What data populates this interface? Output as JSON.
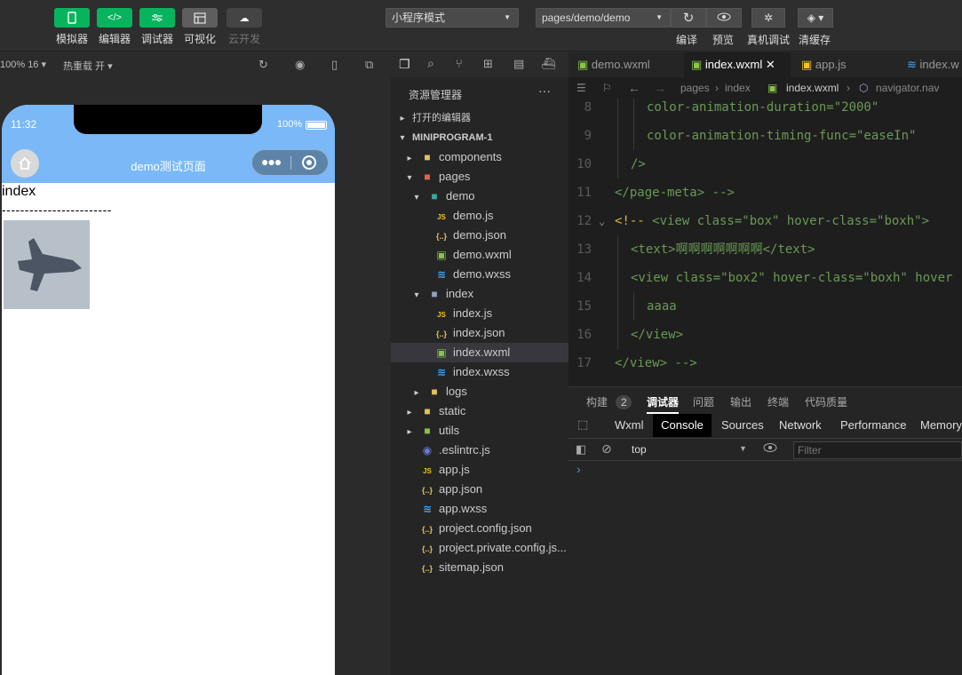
{
  "toolbar": {
    "left_buttons": [
      {
        "label": "模拟器",
        "icon": "phone-icon"
      },
      {
        "label": "编辑器",
        "icon": "code-icon"
      },
      {
        "label": "调试器",
        "icon": "debug-icon"
      },
      {
        "label": "可视化",
        "icon": "layout-icon"
      },
      {
        "label": "云开发",
        "icon": "cloud-icon"
      }
    ],
    "mode_select": "小程序模式",
    "page_select": "pages/demo/demo",
    "right_buttons": [
      {
        "label": "编译",
        "icon": "refresh-icon"
      },
      {
        "label": "预览",
        "icon": "eye-icon"
      },
      {
        "label": "真机调试",
        "icon": "bug-icon"
      },
      {
        "label": "清缓存",
        "icon": "layers-icon"
      }
    ]
  },
  "sim_bar": {
    "zoom": "100% 16",
    "hot_reload": "热重载 开"
  },
  "phone": {
    "time": "11:32",
    "battery": "100%",
    "nav_title": "demo测试页面",
    "content_text": "index",
    "dashes": "------------------------"
  },
  "explorer": {
    "title": "资源管理器",
    "more": "···",
    "open_editors": "打开的编辑器",
    "root": "MINIPROGRAM-1",
    "items": [
      {
        "label": "components",
        "depth": 1,
        "kind": "folder",
        "arrow": "▸"
      },
      {
        "label": "pages",
        "depth": 1,
        "kind": "folder-red",
        "arrow": "▾"
      },
      {
        "label": "demo",
        "depth": 2,
        "kind": "folder-teal",
        "arrow": "▾"
      },
      {
        "label": "demo.js",
        "depth": 3,
        "kind": "js"
      },
      {
        "label": "demo.json",
        "depth": 3,
        "kind": "json"
      },
      {
        "label": "demo.wxml",
        "depth": 3,
        "kind": "wxml"
      },
      {
        "label": "demo.wxss",
        "depth": 3,
        "kind": "wxss"
      },
      {
        "label": "index",
        "depth": 2,
        "kind": "folder-gray",
        "arrow": "▾"
      },
      {
        "label": "index.js",
        "depth": 3,
        "kind": "js"
      },
      {
        "label": "index.json",
        "depth": 3,
        "kind": "json"
      },
      {
        "label": "index.wxml",
        "depth": 3,
        "kind": "wxml",
        "selected": true
      },
      {
        "label": "index.wxss",
        "depth": 3,
        "kind": "wxss"
      },
      {
        "label": "logs",
        "depth": 2,
        "kind": "folder",
        "arrow": "▸"
      },
      {
        "label": "static",
        "depth": 1,
        "kind": "folder",
        "arrow": "▸"
      },
      {
        "label": "utils",
        "depth": 1,
        "kind": "folder-green",
        "arrow": "▸"
      },
      {
        "label": ".eslintrc.js",
        "depth": 1,
        "kind": "eslint"
      },
      {
        "label": "app.js",
        "depth": 1,
        "kind": "js"
      },
      {
        "label": "app.json",
        "depth": 1,
        "kind": "json"
      },
      {
        "label": "app.wxss",
        "depth": 1,
        "kind": "wxss"
      },
      {
        "label": "project.config.json",
        "depth": 1,
        "kind": "json"
      },
      {
        "label": "project.private.config.js...",
        "depth": 1,
        "kind": "json"
      },
      {
        "label": "sitemap.json",
        "depth": 1,
        "kind": "json"
      }
    ]
  },
  "editor": {
    "tabs": [
      {
        "label": "demo.wxml",
        "kind": "wxml"
      },
      {
        "label": "index.wxml",
        "kind": "wxml",
        "active": true,
        "close": "✕"
      },
      {
        "label": "app.js",
        "kind": "js"
      },
      {
        "label": "index.w",
        "kind": "wxss"
      }
    ],
    "breadcrumb": [
      "pages",
      "index",
      "index.wxml",
      "navigator.nav"
    ],
    "lines": [
      {
        "n": "8",
        "indent": 2,
        "text": "color-animation-duration=\"2000\""
      },
      {
        "n": "9",
        "indent": 2,
        "text": "color-animation-timing-func=\"easeIn\""
      },
      {
        "n": "10",
        "indent": 1,
        "text": "/>"
      },
      {
        "n": "11",
        "indent": 0,
        "text": "</page-meta> -->"
      },
      {
        "n": "12",
        "indent": 0,
        "text": "<!-- <view class=\"box\" hover-class=\"boxh\">",
        "fold": "⌄"
      },
      {
        "n": "13",
        "indent": 1,
        "text": "<text>啊啊啊啊啊啊啊</text>"
      },
      {
        "n": "14",
        "indent": 1,
        "text": "<view class=\"box2\" hover-class=\"boxh\" hover"
      },
      {
        "n": "15",
        "indent": 2,
        "text": "aaaa"
      },
      {
        "n": "16",
        "indent": 1,
        "text": "</view>"
      },
      {
        "n": "17",
        "indent": 0,
        "text": "</view> -->"
      }
    ]
  },
  "panel": {
    "tabs": [
      {
        "label": "构建",
        "badge": "2"
      },
      {
        "label": "调试器",
        "active": true
      },
      {
        "label": "问题"
      },
      {
        "label": "输出"
      },
      {
        "label": "终端"
      },
      {
        "label": "代码质量"
      }
    ],
    "devtools_tabs": [
      "Wxml",
      "Console",
      "Sources",
      "Network",
      "Performance",
      "Memory"
    ],
    "active_devtool": "Console",
    "context": "top",
    "filter_placeholder": "Filter",
    "prompt": "›"
  },
  "colors": {
    "accent_green": "#07b45d",
    "nav_blue": "#7ab8f7",
    "code_green": "#6a9955",
    "selected_row": "#37373d"
  }
}
